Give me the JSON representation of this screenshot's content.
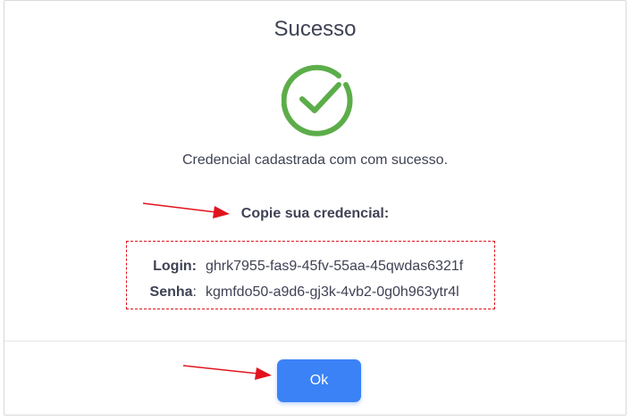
{
  "dialog": {
    "title": "Sucesso",
    "icon": "check-circle-icon",
    "icon_color": "#5cad4a",
    "message": "Credencial cadastrada com com sucesso.",
    "copy_label": "Copie sua credencial:",
    "credentials": {
      "login_label": "Login",
      "login_value": "ghrk7955-fas9-45fv-55aa-45qwdas6321f",
      "password_label": "Senha",
      "password_value": "kgmfdo50-a9d6-gj3k-4vb2-0g0h963ytr4l",
      "separator": ":"
    },
    "ok_label": "Ok"
  },
  "annotations": {
    "arrow_color": "#e1141e",
    "highlight_color": "#e1141e",
    "arrow_icon": "arrow-right-icon"
  },
  "colors": {
    "button": "#3b82f6",
    "text": "#3f4254"
  }
}
